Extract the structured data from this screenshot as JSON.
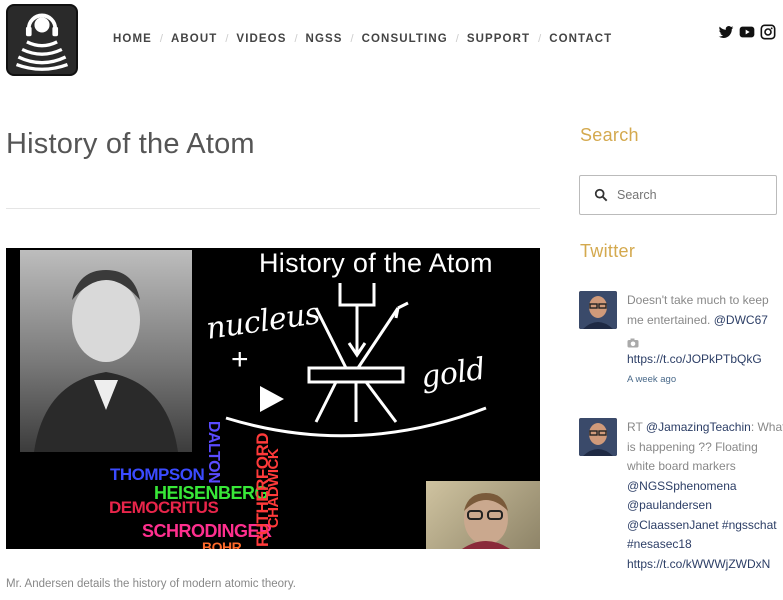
{
  "nav": {
    "items": [
      "HOME",
      "ABOUT",
      "VIDEOS",
      "NGSS",
      "CONSULTING",
      "SUPPORT",
      "CONTACT"
    ]
  },
  "social": [
    "twitter-icon",
    "youtube-icon",
    "instagram-icon"
  ],
  "main": {
    "title": "History of the Atom",
    "video": {
      "title_overlay": "History of the Atom",
      "words": {
        "nucleus": "nucleus",
        "plus": "+",
        "gold": "gold",
        "thompson": "THOMPSON",
        "dalton": "DALTON",
        "heisenberg": "HEISENBERG",
        "democritus": "DEMOCRITUS",
        "schrodinger": "SCHRODINGER",
        "rutherford": "RUTHERFORD",
        "chadwick": "CHADWICK",
        "bohr": "BOHR"
      }
    },
    "caption": "Mr. Andersen details the history of modern atomic theory."
  },
  "sidebar": {
    "search_heading": "Search",
    "search_placeholder": "Search",
    "twitter_heading": "Twitter",
    "tweets": [
      {
        "text": "Doesn't take much to keep me entertained.",
        "mention": "@DWC67",
        "link": "https://t.co/JOPkPTbQkG",
        "time": "A week ago"
      },
      {
        "prefix": "RT",
        "mention": "@JamazingTeachin",
        "text": "What is happening ?? Floating white board markers",
        "mentions2": "@NGSSphenomena @paulandersen @ClaassenJanet #ngsschat #nesasec18",
        "link": "https://t.co/kWWWjZWDxN"
      }
    ]
  },
  "colors": {
    "accent": "#d4a94e",
    "link": "#2c3e66"
  }
}
